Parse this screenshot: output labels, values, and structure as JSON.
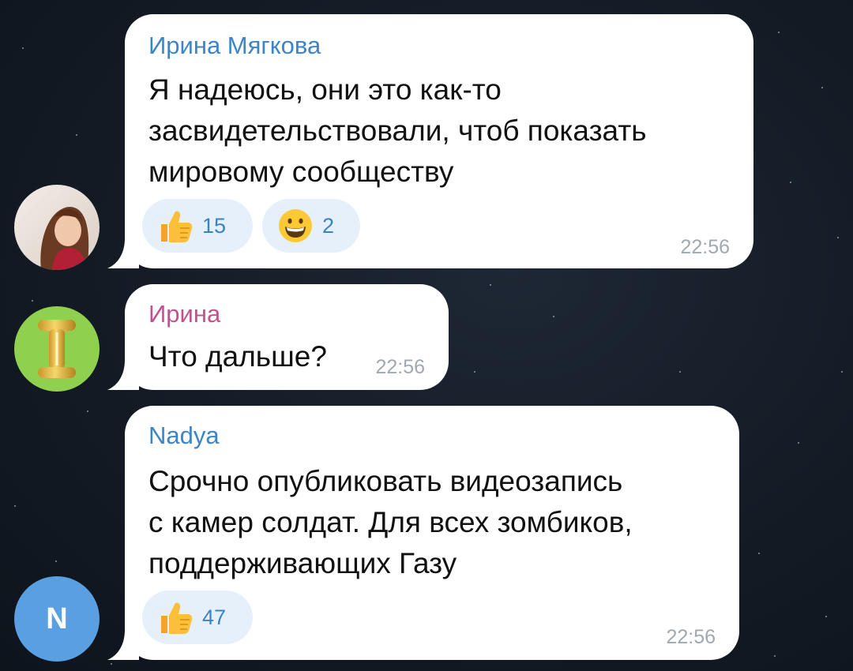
{
  "messages": [
    {
      "sender": "Ирина Мягкова",
      "sender_color": "#3d85c6",
      "text": "Я надеюсь, они это как-то\nзасвидетельствовали, чтоб показать\nмировому сообществу",
      "time": "22:56",
      "reactions": [
        {
          "icon": "thumbs-up-icon",
          "count": "15"
        },
        {
          "icon": "grinning-face-icon",
          "count": "2"
        }
      ],
      "avatar": {
        "type": "photo"
      }
    },
    {
      "sender": "Ирина",
      "sender_color": "#c0538e",
      "text": "Что дальше?",
      "time": "22:56",
      "reactions": [],
      "avatar": {
        "type": "balloon-letter",
        "bg": "#8fd14f"
      }
    },
    {
      "sender": "Nadya",
      "sender_color": "#3d85c6",
      "text": "Срочно опубликовать видеозапись\nс камер солдат. Для всех зомбиков,\nподдерживающих Газу",
      "time": "22:56",
      "reactions": [
        {
          "icon": "thumbs-up-icon",
          "count": "47"
        }
      ],
      "avatar": {
        "type": "initial",
        "letter": "N",
        "bg": "#5b9fe3"
      }
    }
  ]
}
